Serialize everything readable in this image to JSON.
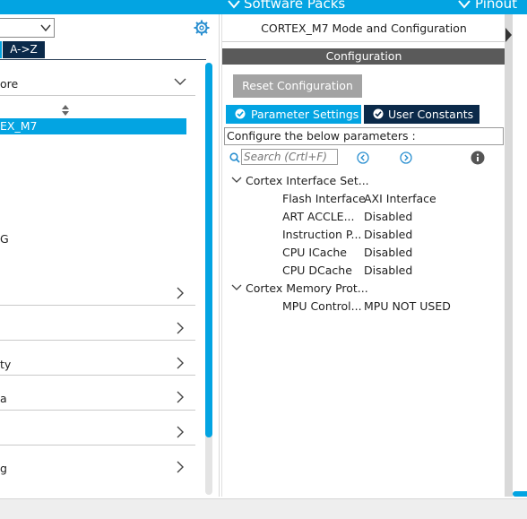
{
  "topbar": {
    "software_packs": "Software Packs",
    "pinout": "Pinout"
  },
  "left": {
    "sort_button": "A->Z",
    "category_label": "ore",
    "selected_item": "EX_M7",
    "item_g": "G",
    "category_rows": [
      "",
      "",
      "ty",
      "a",
      "",
      "g"
    ]
  },
  "right": {
    "title": "CORTEX_M7 Mode and Configuration",
    "config_header": "Configuration",
    "reset_button": "Reset Configuration",
    "tabs": [
      {
        "label": "Parameter Settings"
      },
      {
        "label": "User Constants"
      }
    ],
    "configure_text": "Configure the below parameters :",
    "search_placeholder": "Search (Crtl+F)",
    "groups": [
      {
        "name": "Cortex Interface Set...",
        "params": [
          {
            "name": "Flash Interface",
            "value": "AXI Interface"
          },
          {
            "name": "ART ACCLE...",
            "value": "Disabled"
          },
          {
            "name": "Instruction P...",
            "value": "Disabled"
          },
          {
            "name": "CPU ICache",
            "value": "Disabled"
          },
          {
            "name": "CPU DCache",
            "value": "Disabled"
          }
        ]
      },
      {
        "name": "Cortex Memory Prot...",
        "params": [
          {
            "name": "MPU Control...",
            "value": "MPU NOT USED"
          }
        ]
      }
    ]
  },
  "colors": {
    "accent_blue": "#03a4e2",
    "dark_navy": "#0b2a4a",
    "header_gray": "#5a5a5a",
    "button_gray": "#a3a3a3"
  }
}
